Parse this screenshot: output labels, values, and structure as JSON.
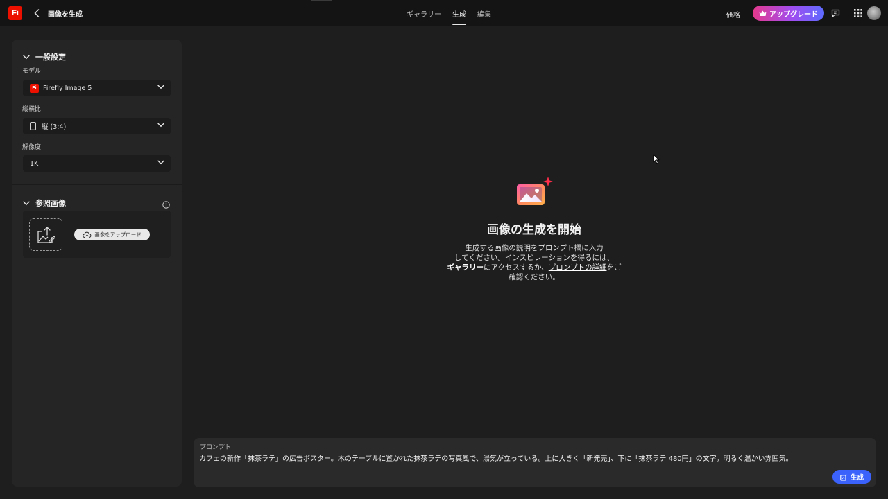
{
  "header": {
    "logo": "Fi",
    "title": "画像を生成",
    "nav_tabs": [
      {
        "label": "ギャラリー"
      },
      {
        "label": "生成"
      },
      {
        "label": "編集"
      }
    ],
    "active_tab": "生成",
    "price_label": "価格",
    "upgrade_label": "アップグレード",
    "upgrade_gradient": [
      "#e5398c",
      "#a04df0",
      "#5d6bff"
    ],
    "brand_color": "#eb1000"
  },
  "sidebar": {
    "general": {
      "title": "一般設定",
      "model_label": "モデル",
      "model_value": "Firefly Image 5",
      "model_logo": "Fi",
      "aspect_label": "縦横比",
      "aspect_value": "縦 (3:4)",
      "resolution_label": "解像度",
      "resolution_value": "1K"
    },
    "reference": {
      "title": "参照画像",
      "upload_label": "画像をアップロード"
    }
  },
  "main": {
    "empty_title": "画像の生成を開始",
    "desc_line1": "生成する画像の説明をプロンプト欄に入力",
    "desc_line2": "してください。インスピレーションを得るには、",
    "desc_gallery": "ギャラリー",
    "desc_mid": "にアクセスするか、",
    "desc_link": "プロンプトの詳細",
    "desc_tail": "をご",
    "desc_line4": "確認ください。"
  },
  "prompt": {
    "label": "プロンプト",
    "text": "カフェの新作「抹茶ラテ」の広告ポスター。木のテーブルに置かれた抹茶ラテの写真風で、湯気が立っている。上に大きく「新発売」、下に「抹茶ラテ 480円」の文字。明るく温かい雰囲気。",
    "generate_label": "生成",
    "generate_color": "#3b63fb"
  }
}
